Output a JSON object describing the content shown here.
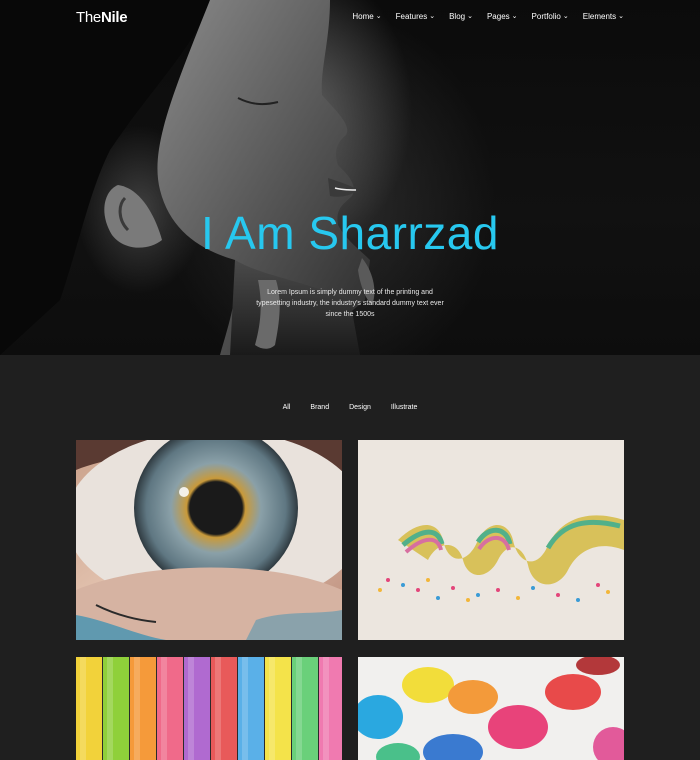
{
  "brand": {
    "logo_light": "The",
    "logo_bold": "Nile"
  },
  "nav": {
    "items": [
      {
        "label": "Home"
      },
      {
        "label": "Features"
      },
      {
        "label": "Blog"
      },
      {
        "label": "Pages"
      },
      {
        "label": "Portfolio"
      },
      {
        "label": "Elements"
      }
    ]
  },
  "hero": {
    "title": "I Am Sharrzad",
    "subtitle": "Lorem Ipsum is simply dummy text of the printing and typesetting industry, the industry's standard dummy text ever since the 1500s"
  },
  "filters": [
    {
      "label": "All"
    },
    {
      "label": "Brand"
    },
    {
      "label": "Design"
    },
    {
      "label": "Illustrate"
    }
  ],
  "colors": {
    "accent": "#27c8ef",
    "background": "#1f1f1f",
    "hero_background": "#0d0d0d"
  }
}
